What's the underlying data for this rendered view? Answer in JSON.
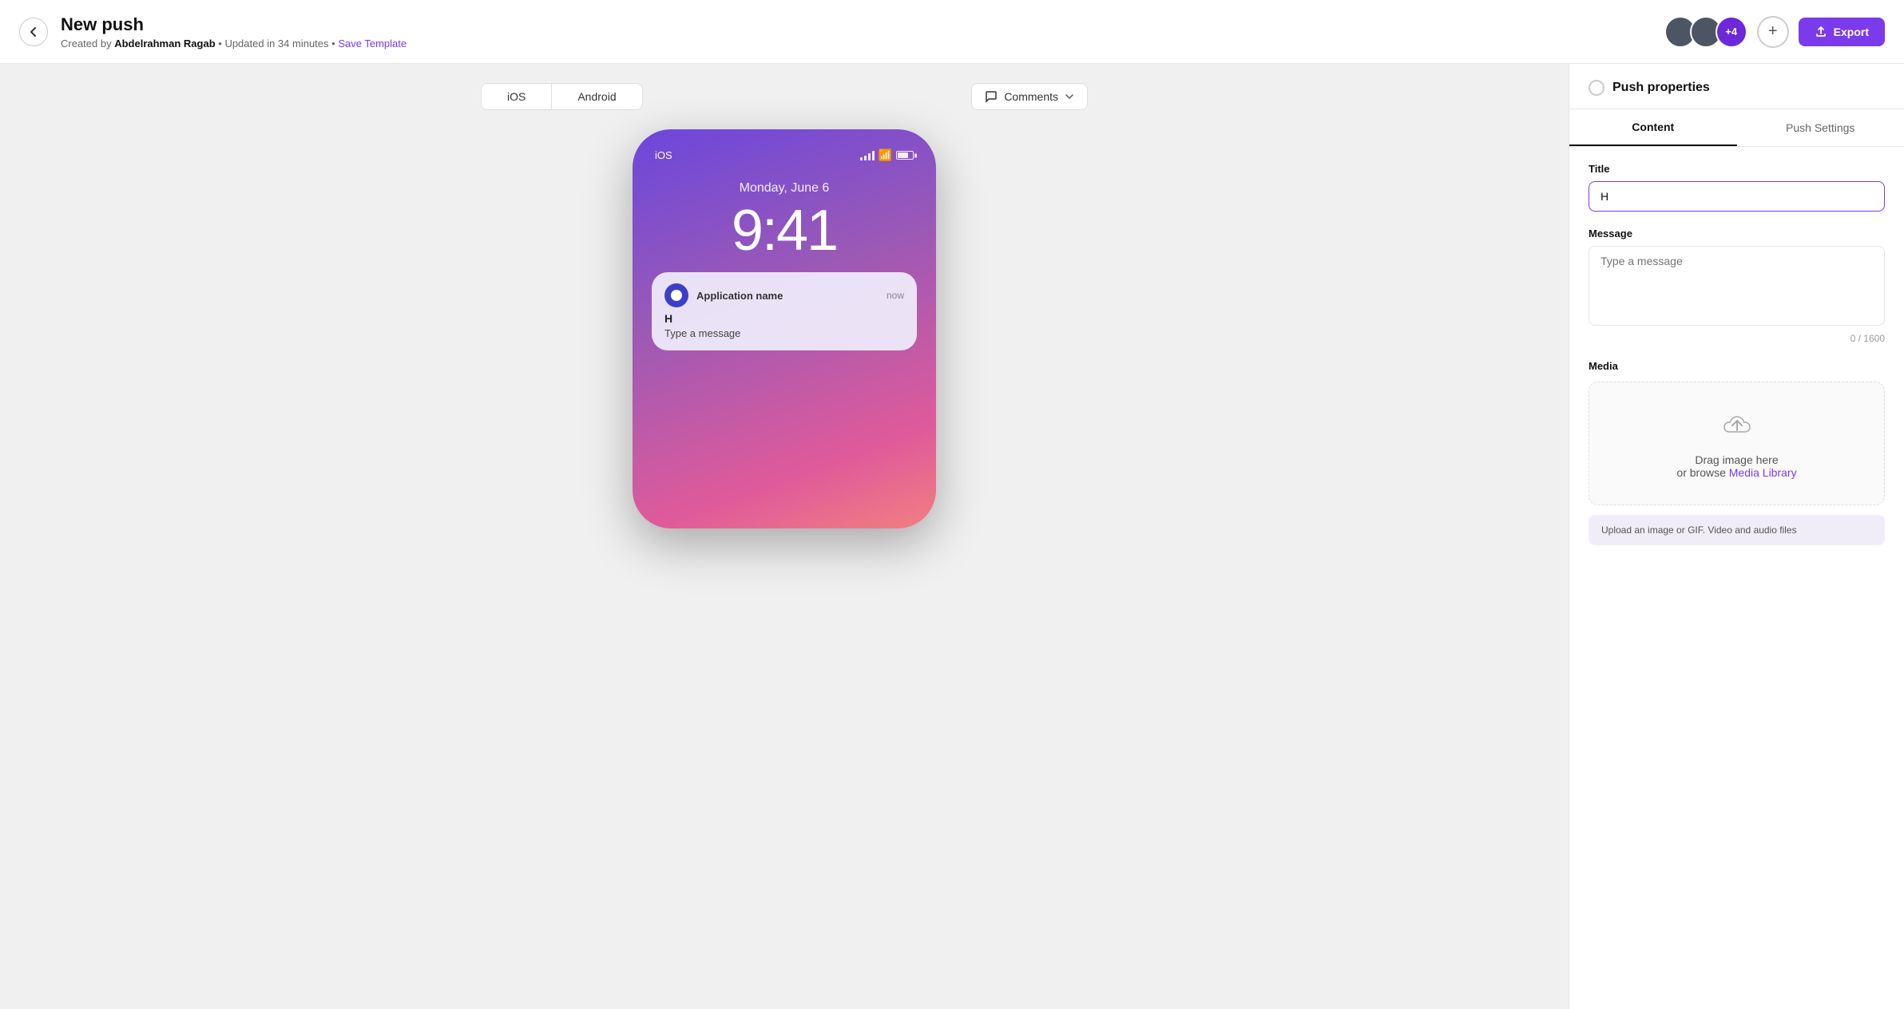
{
  "header": {
    "title": "New push",
    "subtitle_created": "Created by",
    "author": "Abdelrahman Ragab",
    "updated": "Updated in 34 minutes",
    "save_template": "Save Template",
    "avatar_count": "+4",
    "export_label": "Export"
  },
  "canvas": {
    "tabs": [
      {
        "id": "ios",
        "label": "iOS",
        "active": true
      },
      {
        "id": "android",
        "label": "Android",
        "active": false
      }
    ],
    "comments_label": "Comments",
    "phone": {
      "platform": "iOS",
      "date": "Monday, June 6",
      "time": "9:41",
      "notification": {
        "app_name": "Application name",
        "time": "now",
        "title": "H",
        "message": "Type a message"
      }
    }
  },
  "panel": {
    "header_title": "Push properties",
    "tabs": [
      {
        "id": "content",
        "label": "Content",
        "active": true
      },
      {
        "id": "push-settings",
        "label": "Push Settings",
        "active": false
      }
    ],
    "form": {
      "title_label": "Title",
      "title_value": "H",
      "message_label": "Message",
      "message_placeholder": "Type a message",
      "char_count": "0 / 1600",
      "media_label": "Media",
      "upload_drag": "Drag image here",
      "upload_or": "or browse",
      "upload_link": "Media Library",
      "media_note": "Upload an image or GIF. Video and audio files"
    }
  }
}
